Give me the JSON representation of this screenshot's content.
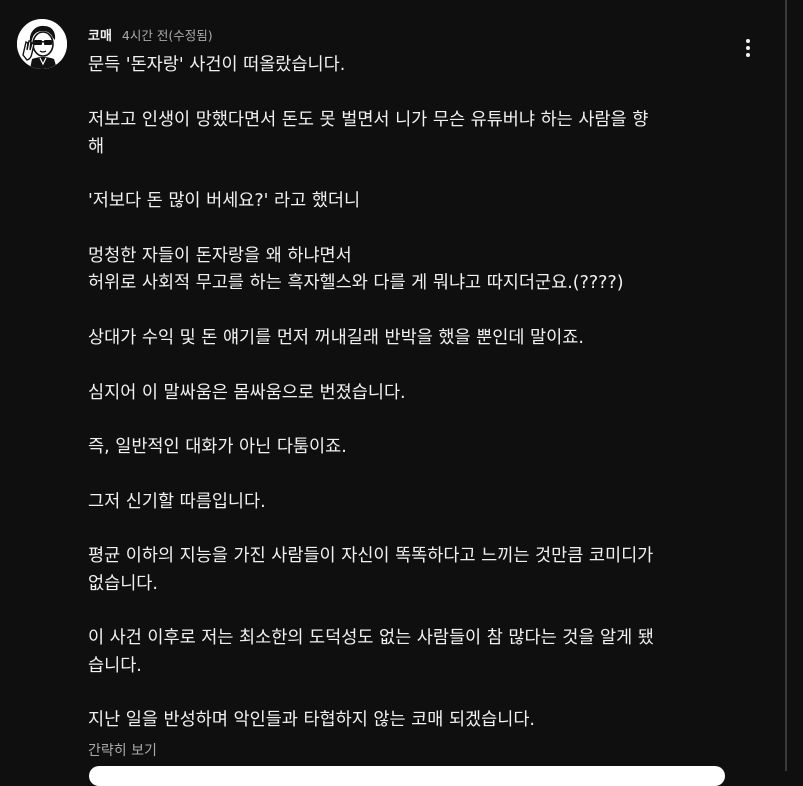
{
  "comment": {
    "author": "코매",
    "time": "4시간 전(수정됨)",
    "paragraphs": [
      "문득 '돈자랑' 사건이 떠올랐습니다.",
      "저보고 인생이 망했다면서 돈도 못 벌면서 니가 무슨 유튜버냐 하는 사람을 향\n해",
      "'저보다 돈 많이 버세요?' 라고 했더니",
      "멍청한 자들이 돈자랑을 왜 하냐면서\n허위로 사회적 무고를 하는 흑자헬스와 다를 게 뭐냐고 따지더군요.(????)",
      "상대가 수익 및 돈 얘기를 먼저 꺼내길래 반박을 했을 뿐인데 말이죠.",
      "심지어 이 말싸움은 몸싸움으로 번졌습니다.",
      "즉, 일반적인 대화가 아닌 다툼이죠.",
      "그저 신기할 따름입니다.",
      "평균 이하의 지능을 가진 사람들이 자신이 똑똑하다고 느끼는 것만큼 코미디가\n없습니다.",
      "이 사건 이후로 저는 최소한의 도덕성도 없는 사람들이 참 많다는 것을 알게 됐\n습니다.",
      "지난 일을 반성하며 악인들과 타협하지 않는 코매 되겠습니다."
    ],
    "show_less": "간략히 보기"
  },
  "icons": {
    "avatar": "avatar-illustration",
    "menu": "more-vertical-icon"
  },
  "colors": {
    "background": "#0f0f0f",
    "text": "#f1f1f1",
    "secondary": "#aaaaaa"
  }
}
